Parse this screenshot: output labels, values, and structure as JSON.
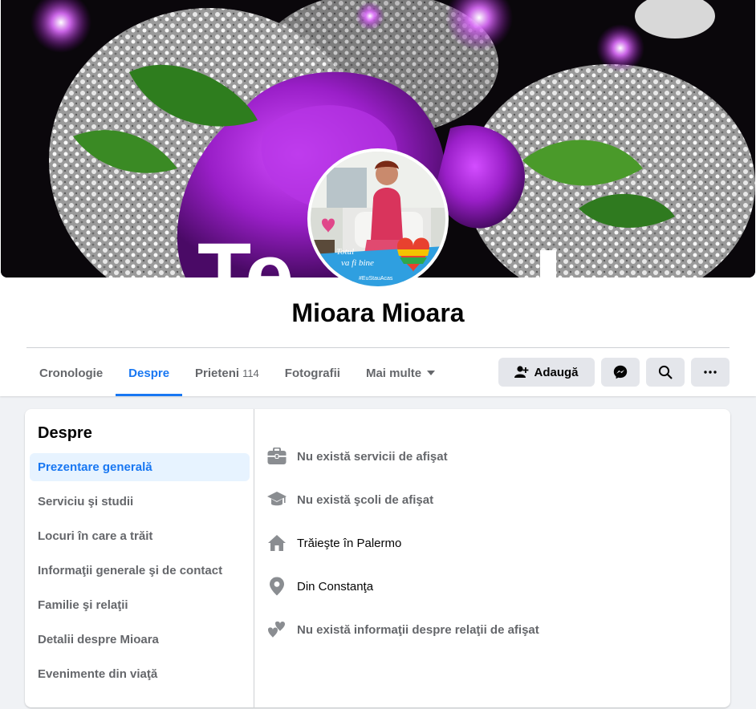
{
  "profile": {
    "name": "Mioara Mioara",
    "cover_text": "Te",
    "avatar_caption_1": "Totul",
    "avatar_caption_2": "va fi bine",
    "avatar_hashtag": "#EuStauAcas"
  },
  "tabs": [
    {
      "label": "Cronologie"
    },
    {
      "label": "Despre"
    },
    {
      "label": "Prieteni",
      "count": "114"
    },
    {
      "label": "Fotografii"
    },
    {
      "label": "Mai multe"
    }
  ],
  "actions": {
    "add_friend_label": "Adaugă"
  },
  "about": {
    "title": "Despre",
    "menu": [
      {
        "label": "Prezentare generală"
      },
      {
        "label": "Serviciu şi studii"
      },
      {
        "label": "Locuri în care a trăit"
      },
      {
        "label": "Informaţii generale şi de contact"
      },
      {
        "label": "Familie şi relaţii"
      },
      {
        "label": "Detalii despre Mioara"
      },
      {
        "label": "Evenimente din viaţă"
      }
    ],
    "overview": [
      {
        "icon": "briefcase-icon",
        "text": "Nu există servicii de afişat"
      },
      {
        "icon": "graduation-cap-icon",
        "text": "Nu există şcoli de afişat"
      },
      {
        "icon": "home-icon",
        "text": "Trăieşte în Palermo"
      },
      {
        "icon": "location-pin-icon",
        "text": "Din Constanţa"
      },
      {
        "icon": "hearts-icon",
        "text": "Nu există informaţii despre relaţii de afişat"
      }
    ]
  },
  "colors": {
    "accent": "#1877f2",
    "button_bg": "#e4e6eb",
    "page_bg": "#f0f2f5"
  }
}
